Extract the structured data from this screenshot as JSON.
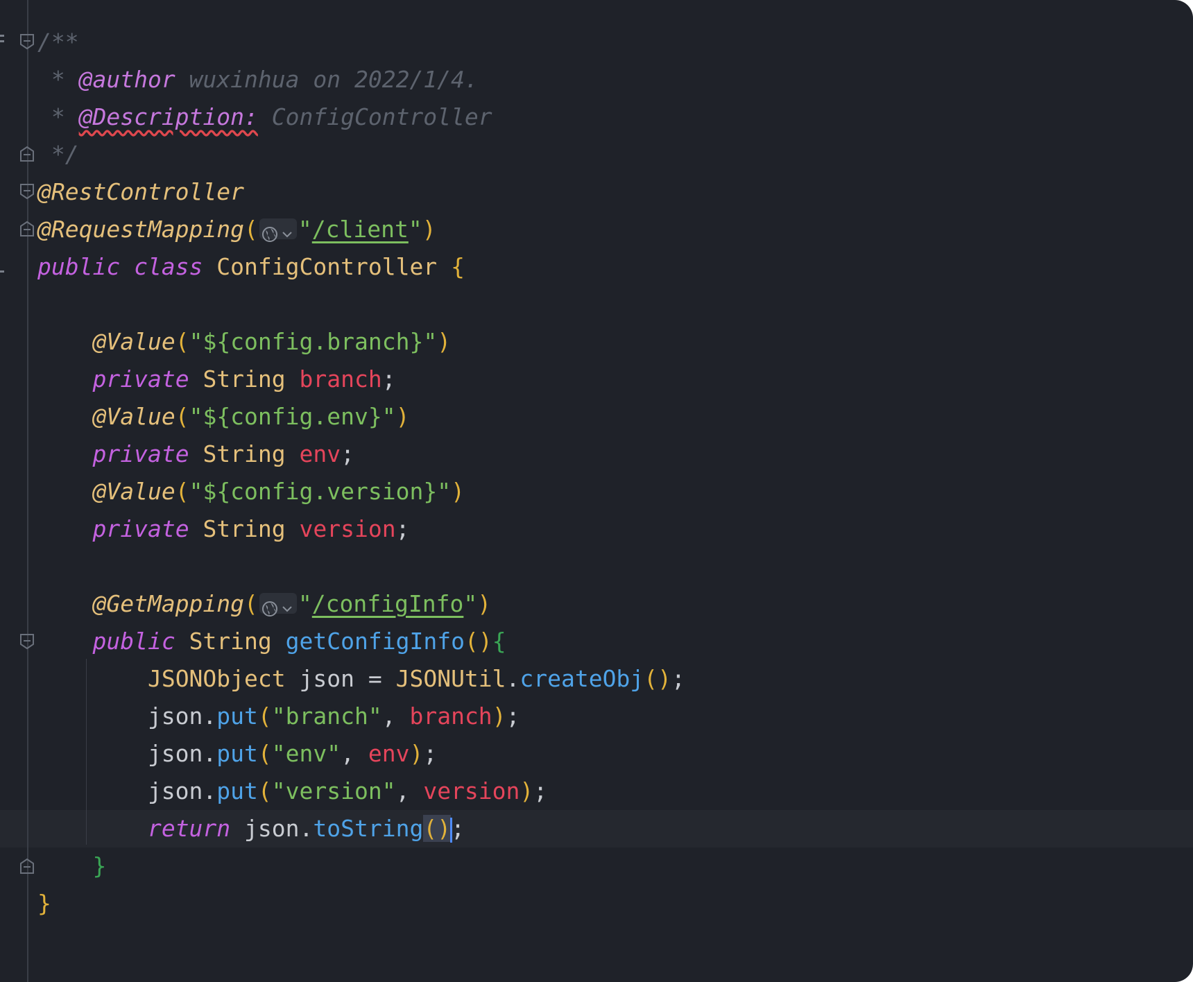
{
  "editor": {
    "lines": [
      {
        "tokens": [
          {
            "c": "cmt",
            "t": "/**"
          }
        ]
      },
      {
        "tokens": [
          {
            "c": "cmt",
            "t": " * "
          },
          {
            "c": "tag",
            "t": "@author"
          },
          {
            "c": "cmt",
            "t": " wuxinhua on 2022/1/4."
          }
        ]
      },
      {
        "tokens": [
          {
            "c": "cmt",
            "t": " * "
          },
          {
            "c": "tag-err",
            "t": "@Description:"
          },
          {
            "c": "cmt",
            "t": " ConfigController"
          }
        ]
      },
      {
        "tokens": [
          {
            "c": "cmt",
            "t": " */"
          }
        ]
      },
      {
        "tokens": [
          {
            "c": "ann",
            "t": "@RestController"
          }
        ]
      },
      {
        "tokens": [
          {
            "c": "ann",
            "t": "@RequestMapping"
          },
          {
            "c": "paren",
            "t": "("
          },
          {
            "c": "globe",
            "t": ""
          },
          {
            "c": "str",
            "t": "\""
          },
          {
            "c": "link",
            "t": "/client"
          },
          {
            "c": "str",
            "t": "\""
          },
          {
            "c": "paren",
            "t": ")"
          }
        ]
      },
      {
        "tokens": [
          {
            "c": "kw",
            "t": "public class"
          },
          {
            "c": "punc",
            "t": " "
          },
          {
            "c": "type",
            "t": "ConfigController"
          },
          {
            "c": "punc",
            "t": " "
          },
          {
            "c": "brace",
            "t": "{"
          }
        ]
      },
      {
        "tokens": []
      },
      {
        "tokens": [
          {
            "c": "punc",
            "t": "    "
          },
          {
            "c": "ann",
            "t": "@Value"
          },
          {
            "c": "paren",
            "t": "("
          },
          {
            "c": "str",
            "t": "\"${config.branch}\""
          },
          {
            "c": "paren",
            "t": ")"
          }
        ]
      },
      {
        "tokens": [
          {
            "c": "punc",
            "t": "    "
          },
          {
            "c": "kw",
            "t": "private"
          },
          {
            "c": "punc",
            "t": " "
          },
          {
            "c": "type",
            "t": "String"
          },
          {
            "c": "punc",
            "t": " "
          },
          {
            "c": "field",
            "t": "branch"
          },
          {
            "c": "punc",
            "t": ";"
          }
        ]
      },
      {
        "tokens": [
          {
            "c": "punc",
            "t": "    "
          },
          {
            "c": "ann",
            "t": "@Value"
          },
          {
            "c": "paren",
            "t": "("
          },
          {
            "c": "str",
            "t": "\"${config.env}\""
          },
          {
            "c": "paren",
            "t": ")"
          }
        ]
      },
      {
        "tokens": [
          {
            "c": "punc",
            "t": "    "
          },
          {
            "c": "kw",
            "t": "private"
          },
          {
            "c": "punc",
            "t": " "
          },
          {
            "c": "type",
            "t": "String"
          },
          {
            "c": "punc",
            "t": " "
          },
          {
            "c": "field",
            "t": "env"
          },
          {
            "c": "punc",
            "t": ";"
          }
        ]
      },
      {
        "tokens": [
          {
            "c": "punc",
            "t": "    "
          },
          {
            "c": "ann",
            "t": "@Value"
          },
          {
            "c": "paren",
            "t": "("
          },
          {
            "c": "str",
            "t": "\"${config.version}\""
          },
          {
            "c": "paren",
            "t": ")"
          }
        ]
      },
      {
        "tokens": [
          {
            "c": "punc",
            "t": "    "
          },
          {
            "c": "kw",
            "t": "private"
          },
          {
            "c": "punc",
            "t": " "
          },
          {
            "c": "type",
            "t": "String"
          },
          {
            "c": "punc",
            "t": " "
          },
          {
            "c": "field",
            "t": "version"
          },
          {
            "c": "punc",
            "t": ";"
          }
        ]
      },
      {
        "tokens": []
      },
      {
        "tokens": [
          {
            "c": "punc",
            "t": "    "
          },
          {
            "c": "ann",
            "t": "@GetMapping"
          },
          {
            "c": "paren",
            "t": "("
          },
          {
            "c": "globe",
            "t": ""
          },
          {
            "c": "str",
            "t": "\""
          },
          {
            "c": "link",
            "t": "/configInfo"
          },
          {
            "c": "str",
            "t": "\""
          },
          {
            "c": "paren",
            "t": ")"
          }
        ]
      },
      {
        "tokens": [
          {
            "c": "punc",
            "t": "    "
          },
          {
            "c": "kw",
            "t": "public"
          },
          {
            "c": "punc",
            "t": " "
          },
          {
            "c": "type",
            "t": "String"
          },
          {
            "c": "punc",
            "t": " "
          },
          {
            "c": "fn",
            "t": "getConfigInfo"
          },
          {
            "c": "paren",
            "t": "()"
          },
          {
            "c": "brace-g",
            "t": "{"
          }
        ]
      },
      {
        "tokens": [
          {
            "c": "punc",
            "t": "        "
          },
          {
            "c": "type",
            "t": "JSONObject"
          },
          {
            "c": "punc",
            "t": " json = "
          },
          {
            "c": "type",
            "t": "JSONUtil"
          },
          {
            "c": "punc",
            "t": "."
          },
          {
            "c": "fn",
            "t": "createObj"
          },
          {
            "c": "paren",
            "t": "()"
          },
          {
            "c": "punc",
            "t": ";"
          }
        ]
      },
      {
        "tokens": [
          {
            "c": "punc",
            "t": "        json."
          },
          {
            "c": "fn",
            "t": "put"
          },
          {
            "c": "paren",
            "t": "("
          },
          {
            "c": "str",
            "t": "\"branch\""
          },
          {
            "c": "punc",
            "t": ", "
          },
          {
            "c": "field",
            "t": "branch"
          },
          {
            "c": "paren",
            "t": ")"
          },
          {
            "c": "punc",
            "t": ";"
          }
        ]
      },
      {
        "tokens": [
          {
            "c": "punc",
            "t": "        json."
          },
          {
            "c": "fn",
            "t": "put"
          },
          {
            "c": "paren",
            "t": "("
          },
          {
            "c": "str",
            "t": "\"env\""
          },
          {
            "c": "punc",
            "t": ", "
          },
          {
            "c": "field",
            "t": "env"
          },
          {
            "c": "paren",
            "t": ")"
          },
          {
            "c": "punc",
            "t": ";"
          }
        ]
      },
      {
        "tokens": [
          {
            "c": "punc",
            "t": "        json."
          },
          {
            "c": "fn",
            "t": "put"
          },
          {
            "c": "paren",
            "t": "("
          },
          {
            "c": "str",
            "t": "\"version\""
          },
          {
            "c": "punc",
            "t": ", "
          },
          {
            "c": "field",
            "t": "version"
          },
          {
            "c": "paren",
            "t": ")"
          },
          {
            "c": "punc",
            "t": ";"
          }
        ]
      },
      {
        "tokens": [
          {
            "c": "punc",
            "t": "        "
          },
          {
            "c": "kw",
            "t": "return"
          },
          {
            "c": "punc",
            "t": " json."
          },
          {
            "c": "fn",
            "t": "toString"
          },
          {
            "c": "paren-hl",
            "t": "()"
          },
          {
            "c": "caret",
            "t": ""
          },
          {
            "c": "punc",
            "t": ";"
          }
        ]
      },
      {
        "tokens": [
          {
            "c": "punc",
            "t": "    "
          },
          {
            "c": "brace-g",
            "t": "}"
          }
        ]
      },
      {
        "tokens": [
          {
            "c": "brace",
            "t": "}"
          }
        ]
      }
    ]
  },
  "colors": {
    "background": "#1f2229",
    "keyword": "#c462e0",
    "annotation": "#e5c07b",
    "string": "#7dbf5f",
    "field": "#e5455b",
    "function": "#4fa3e8",
    "comment": "#5d636e"
  },
  "icons": {
    "fold": "fold-marker-icon",
    "globe": "globe-icon",
    "caret": "text-caret"
  }
}
